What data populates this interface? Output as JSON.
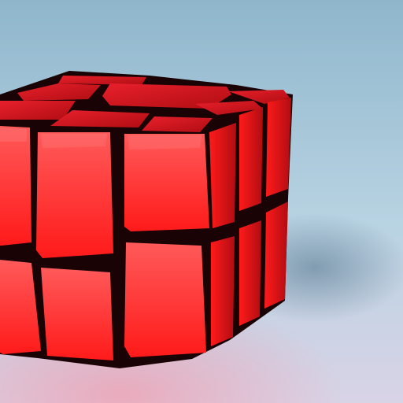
{
  "photo": {
    "subject": "red-cube-puzzle",
    "colors": {
      "background_top": "#8fb6cc",
      "background_mid": "#b8d3e2",
      "background_bottom": "#d9d3e6",
      "cube_red": "#ff1a1a",
      "cube_red_light": "#ff5a5a",
      "cube_red_dark": "#b00d12",
      "cube_top_red": "#e8202c",
      "cube_frame": "#1a0304",
      "shadow": "#5f7f96"
    }
  }
}
